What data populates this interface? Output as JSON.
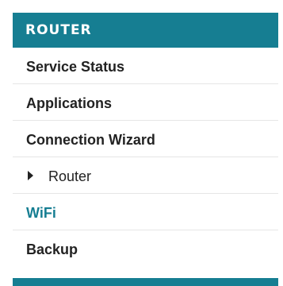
{
  "sidebar": {
    "header": "ROUTER",
    "accent_color": "#167e92",
    "items": [
      {
        "label": "Service Status"
      },
      {
        "label": "Applications"
      },
      {
        "label": "Connection Wizard"
      },
      {
        "label": "Router",
        "active": true,
        "icon": "caret-right-icon"
      },
      {
        "label": "WiFi",
        "highlight": true
      },
      {
        "label": "Backup"
      }
    ]
  }
}
